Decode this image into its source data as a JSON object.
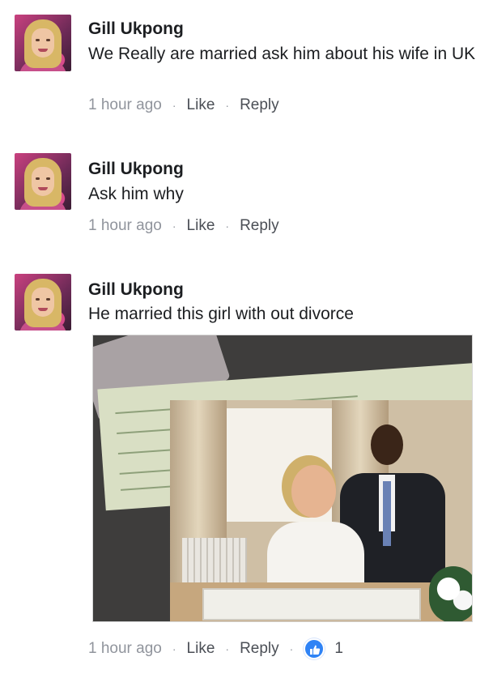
{
  "comments": [
    {
      "author": "Gill Ukpong",
      "text": "We Really are married ask him about his wife in UK",
      "time": "1 hour ago",
      "like_label": "Like",
      "reply_label": "Reply"
    },
    {
      "author": "Gill Ukpong",
      "text": "Ask him why",
      "time": "1 hour ago",
      "like_label": "Like",
      "reply_label": "Reply"
    },
    {
      "author": "Gill Ukpong",
      "text": "He married this girl with out divorce",
      "time": "1 hour ago",
      "like_label": "Like",
      "reply_label": "Reply",
      "reaction_icon": "thumbs-up-icon",
      "reaction_count": "1"
    }
  ],
  "separator": "·",
  "colors": {
    "name": "#1c1e21",
    "meta": "#90949c",
    "reaction_blue": "#2f83f5"
  }
}
